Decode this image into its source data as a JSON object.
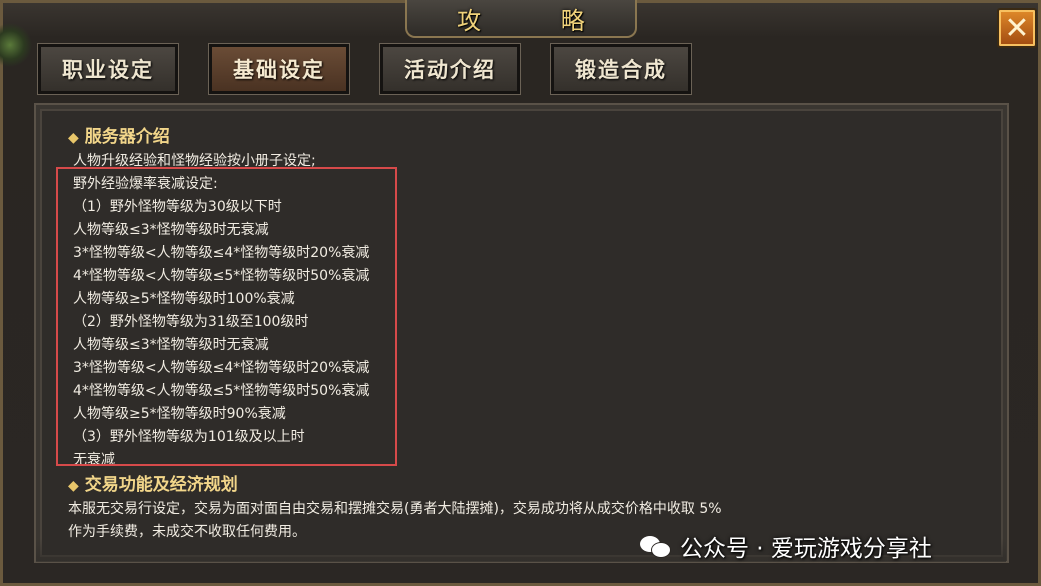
{
  "window": {
    "title": "攻 略",
    "close_label": "✕"
  },
  "tabs": [
    {
      "label": "职业设定",
      "active": false
    },
    {
      "label": "基础设定",
      "active": true
    },
    {
      "label": "活动介绍",
      "active": false
    },
    {
      "label": "锻造合成",
      "active": false
    }
  ],
  "content": {
    "section1_title": "服务器介绍",
    "lines": [
      "人物升级经验和怪物经验按小册子设定;",
      "野外经验爆率衰减设定:",
      "（1）野外怪物等级为30级以下时",
      "人物等级≤3*怪物等级时无衰减",
      "3*怪物等级<人物等级≤4*怪物等级时20%衰减",
      "4*怪物等级<人物等级≤5*怪物等级时50%衰减",
      "人物等级≥5*怪物等级时100%衰减",
      "（2）野外怪物等级为31级至100级时",
      "人物等级≤3*怪物等级时无衰减",
      "3*怪物等级<人物等级≤4*怪物等级时20%衰减",
      "4*怪物等级<人物等级≤5*怪物等级时50%衰减",
      "人物等级≥5*怪物等级时90%衰减",
      "（3）野外怪物等级为101级及以上时",
      "无衰减"
    ],
    "section2_title": "交易功能及经济规划",
    "lines2": [
      "本服无交易行设定，交易为面对面自由交易和摆摊交易(勇者大陆摆摊)，交易成功将从成交价格中收取 5%",
      "作为手续费，未成交不收取任何费用。"
    ]
  },
  "watermark": {
    "text": "公众号 · 爱玩游戏分享社"
  },
  "colors": {
    "accent": "#f2d68a",
    "highlight_box": "#d64a4a",
    "close_button": "#e08a2a"
  }
}
